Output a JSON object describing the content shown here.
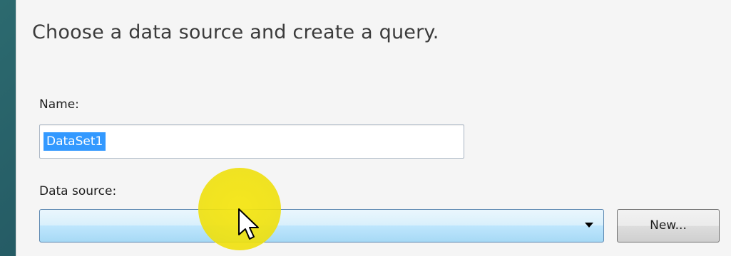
{
  "dialog": {
    "heading": "Choose a data source and create a query."
  },
  "name_field": {
    "label": "Name:",
    "value": "DataSet1",
    "selected": true
  },
  "data_source": {
    "label": "Data source:",
    "selected_value": "",
    "new_button_label": "New..."
  },
  "cursor": {
    "highlight_color": "#f2e213",
    "icon": "arrow-cursor-icon"
  },
  "colors": {
    "selection": "#3399ff",
    "background": "#1f4f5c",
    "panel": "#f5f5f5"
  }
}
